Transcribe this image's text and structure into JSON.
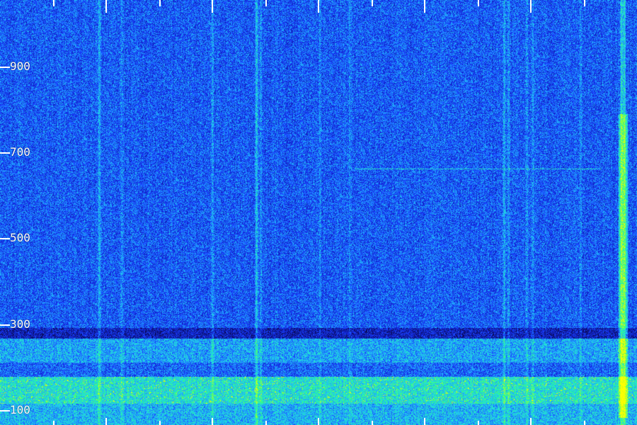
{
  "waterfall": {
    "y_axis_labels": [
      "900",
      "700",
      "500",
      "300",
      "100"
    ],
    "colormap": [
      "#0a0a50",
      "#1020c0",
      "#1a40ff",
      "#20a0ff",
      "#20e0e0",
      "#30ff80",
      "#c0ff20",
      "#ffff00"
    ],
    "background_color": "#0d1478"
  }
}
